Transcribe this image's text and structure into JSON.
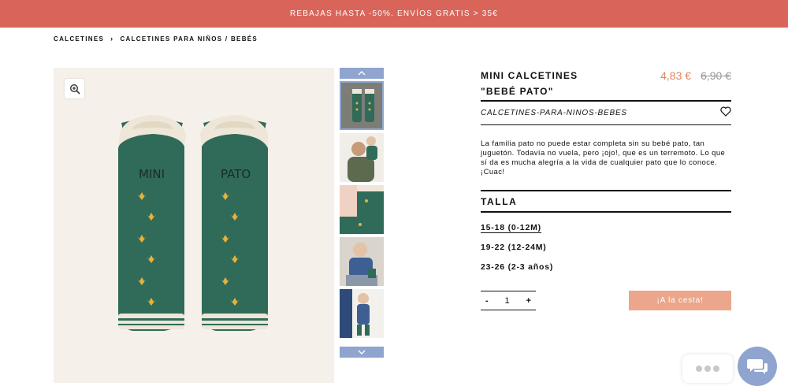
{
  "promo": {
    "text": "REBAJAS HASTA -50%. ENVÍOS GRATIS > 35€"
  },
  "breadcrumb": {
    "items": [
      "CALCETINES",
      "CALCETINES PARA NIÑOS / BEBÉS"
    ],
    "separator": "›"
  },
  "gallery": {
    "zoom_icon": "zoom-in-icon",
    "sock_left_text": "MINI",
    "sock_right_text": "PATO",
    "thumb_up_icon": "chevron-up-icon",
    "thumb_down_icon": "chevron-down-icon",
    "thumbnail_count": 5
  },
  "product": {
    "title": "MINI CALCETINES \"BEBÉ PATO\"",
    "price_now": "4,83 €",
    "price_old": "6,90 €",
    "category": "CALCETINES-PARA-NINOS-BEBES",
    "wishlist_icon": "heart-icon",
    "description": "La familia pato no puede estar completa sin su bebé pato, tan juguetón. Todavía no vuela, pero ¡ojo!, que es un terremoto. Lo que sí da es mucha alegría a la vida de cualquier pato que lo conoce. ¡Cuac!",
    "size_heading": "TALLA",
    "sizes": [
      "15-18 (0-12M)",
      "19-22 (12-24M)",
      "23-26 (2-3 años)"
    ],
    "selected_size": "15-18 (0-12M)",
    "qty_minus": "-",
    "qty_value": "1",
    "qty_plus": "+",
    "add_to_cart": "¡A la cesta!"
  },
  "chat": {
    "icon": "chat-bubbles-icon",
    "typing_icon": "typing-dots-icon"
  },
  "colors": {
    "promo_bg": "#d9655a",
    "accent_blue": "#8fa5cf",
    "price": "#e2855f",
    "cart_button": "#eba68b",
    "sock_green": "#2f6b58",
    "sock_yellow": "#e8b13a"
  }
}
